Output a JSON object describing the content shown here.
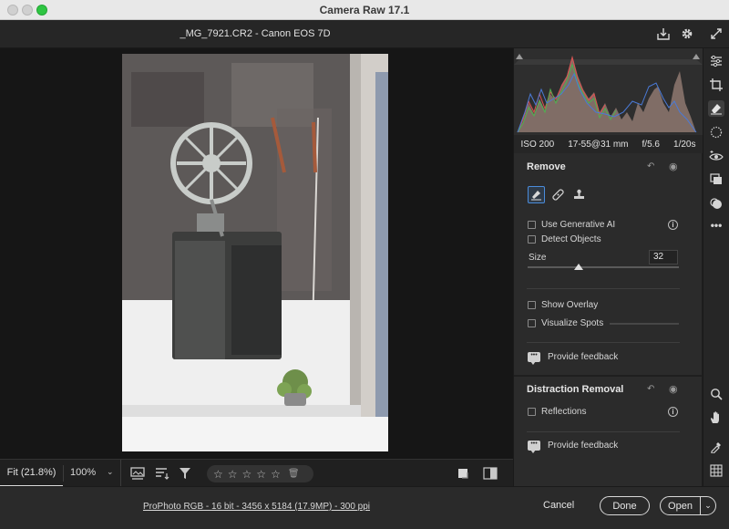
{
  "window": {
    "title": "Camera Raw 17.1"
  },
  "header": {
    "file_title": "_MG_7921.CR2  -  Canon EOS 7D"
  },
  "camera_info": {
    "iso": "ISO 200",
    "lens": "17-55@31 mm",
    "aperture": "f/5.6",
    "shutter": "1/20s"
  },
  "remove": {
    "title": "Remove",
    "use_generative_ai": "Use Generative AI",
    "detect_objects": "Detect Objects",
    "size_label": "Size",
    "size_value": "32",
    "size_level": 0.34,
    "show_overlay": "Show Overlay",
    "visualize_spots": "Visualize Spots",
    "feedback": "Provide feedback"
  },
  "distraction": {
    "title": "Distraction Removal",
    "reflections": "Reflections",
    "feedback": "Provide feedback"
  },
  "bottombar": {
    "fit_label": "Fit (21.8%)",
    "zoom_label": "100%"
  },
  "footer": {
    "workflow": "ProPhoto RGB - 16 bit - 3456 x 5184 (17.9MP) - 300 ppi",
    "cancel": "Cancel",
    "done": "Done",
    "open": "Open"
  },
  "colors": {
    "accent": "#4a8cdb",
    "zoom_green": "#2ec542"
  },
  "icons": [
    "save-icon",
    "gear-icon",
    "expand-icon",
    "sliders-icon",
    "crop-icon",
    "eraser-icon",
    "mask-icon",
    "redeye-icon",
    "presets-icon",
    "snapshots-icon",
    "more-icon",
    "zoom-icon",
    "hand-icon",
    "eyedropper-icon",
    "grid-icon"
  ]
}
